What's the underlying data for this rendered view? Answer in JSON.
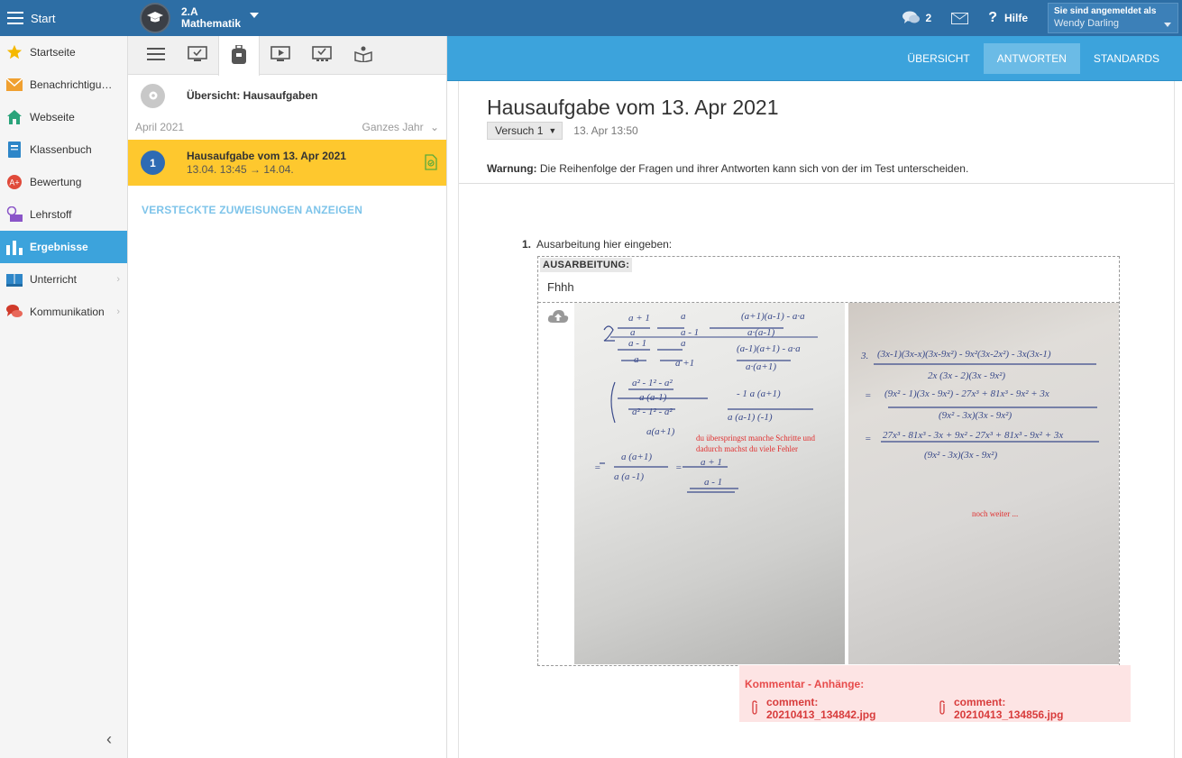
{
  "topbar": {
    "start_label": "Start",
    "class_code": "2.A",
    "class_subject": "Mathematik",
    "messages_count": "2",
    "help_label": "Hilfe",
    "logged_in_label": "Sie sind angemeldet als",
    "user_name": "Wendy Darling"
  },
  "sidebar": {
    "items": [
      {
        "label": "Startseite",
        "icon": "star-icon",
        "color": "#f5b800"
      },
      {
        "label": "Benachrichtigungen",
        "icon": "envelope-icon",
        "color": "#f0a030"
      },
      {
        "label": "Webseite",
        "icon": "home-icon",
        "color": "#2aa37a"
      },
      {
        "label": "Klassenbuch",
        "icon": "book-icon",
        "color": "#2e86c8"
      },
      {
        "label": "Bewertung",
        "icon": "grade-icon",
        "color": "#e04a3a"
      },
      {
        "label": "Lehrstoff",
        "icon": "material-icon",
        "color": "#8a55c8"
      },
      {
        "label": "Ergebnisse",
        "icon": "chart-icon",
        "color": "#ffffff"
      },
      {
        "label": "Unterricht",
        "icon": "open-book-icon",
        "color": "#2e86c8"
      },
      {
        "label": "Kommunikation",
        "icon": "chat-icon",
        "color": "#d03a2a"
      }
    ],
    "active": "Ergebnisse"
  },
  "middle": {
    "overview_label": "Übersicht: Hausaufgaben",
    "month": "April 2021",
    "range": "Ganzes Jahr",
    "assignment": {
      "number": "1",
      "title": "Hausaufgabe vom 13. Apr 2021",
      "dates": "13.04. 13:45 → 14.04."
    },
    "hidden_link": "VERSTECKTE ZUWEISUNGEN ANZEIGEN"
  },
  "right_tabs": [
    "ÜBERSICHT",
    "ANTWORTEN",
    "STANDARDS"
  ],
  "active_tab": "ANTWORTEN",
  "main": {
    "title": "Hausaufgabe vom 13. Apr 2021",
    "attempt": "Versuch 1",
    "attempt_time": "13. Apr 13:50",
    "warning_bold": "Warnung:",
    "warning_text": "Die Reihenfolge der Fragen und ihrer Antworten kann sich von der im Test unterscheiden.",
    "question_number": "1.",
    "question_text": "Ausarbeitung hier eingeben:",
    "answer_label": "AUSARBEITUNG:",
    "answer_text": "Fhhh",
    "photo1_comment_line1": "du überspringst manche Schritte und",
    "photo1_comment_line2": "dadurch machst du viele Fehler",
    "photo2_comment": "noch weiter ...",
    "comment_title": "Kommentar - Anhänge:",
    "attachments": [
      "comment: 20210413_134842.jpg",
      "comment: 20210413_134856.jpg"
    ]
  }
}
